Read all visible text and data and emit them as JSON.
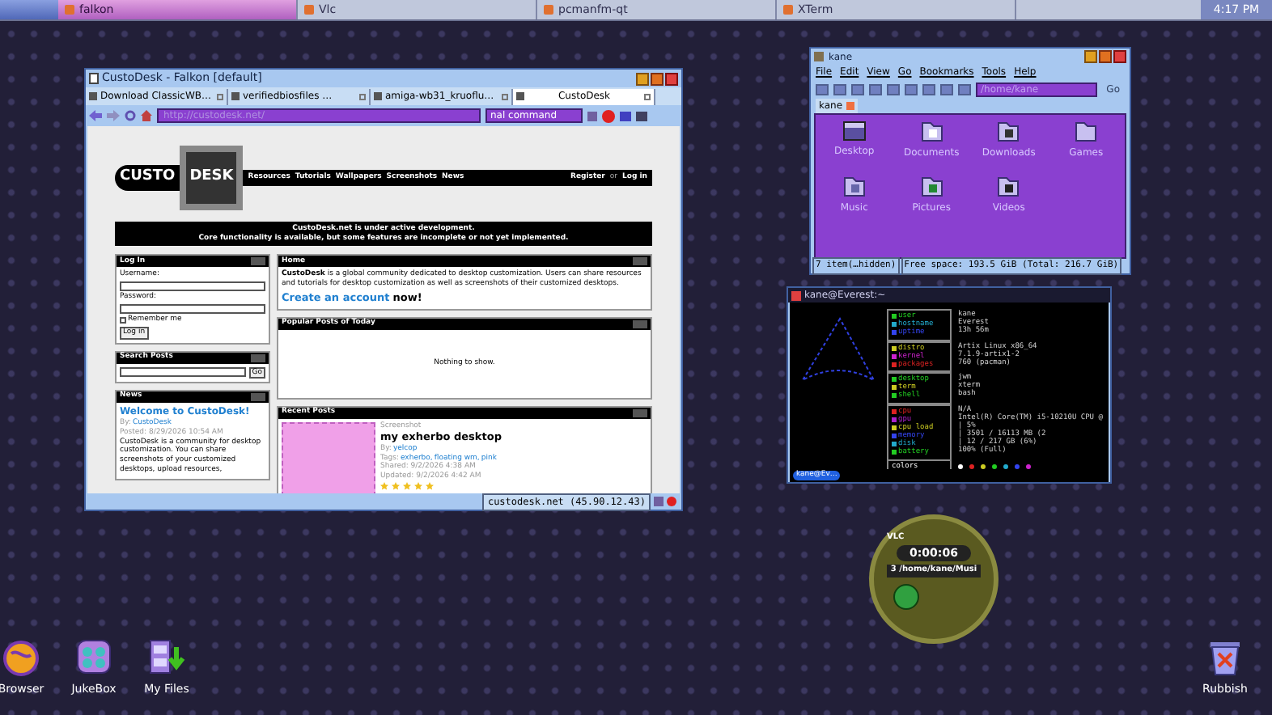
{
  "taskbar": {
    "tasks": [
      {
        "label": "falkon",
        "selected": true
      },
      {
        "label": "Vlc",
        "selected": false
      },
      {
        "label": "pcmanfm-qt",
        "selected": false
      },
      {
        "label": "XTerm",
        "selected": false
      }
    ],
    "clock": "4:17 PM"
  },
  "browser": {
    "title": "CustoDesk - Falkon [default]",
    "tabs": [
      {
        "label": "Download ClassicWB…",
        "selected": false
      },
      {
        "label": "verifiedbiosfiles …",
        "selected": false
      },
      {
        "label": "amiga-wb31_kruoflu…",
        "selected": false
      },
      {
        "label": "CustoDesk",
        "selected": true
      }
    ],
    "url": "http://custodesk.net/",
    "search": "nal command",
    "page": {
      "logo": [
        "CUSTO",
        "DESK"
      ],
      "nav": [
        "Resources",
        "Tutorials",
        "Wallpapers",
        "Screenshots",
        "News"
      ],
      "register": "Register",
      "or": "or",
      "login_link": "Log in",
      "notice": [
        "CustoDesk.net is under active development.",
        "Core functionality is available, but some features are incomplete or not yet implemented."
      ],
      "login": {
        "title": "Log In",
        "username": "Username:",
        "password": "Password:",
        "remember": {
          "label": "Remember me",
          "checked": false
        },
        "button": "Log in"
      },
      "search_posts": {
        "title": "Search Posts",
        "button": "Go"
      },
      "news": {
        "title": "News",
        "headline": "Welcome to CustoDesk!",
        "by": "By:",
        "author": "CustoDesk",
        "posted": "Posted: 8/29/2026 10:54 AM",
        "body": "CustoDesk is a community for desktop customization. You can share screenshots of your customized desktops, upload resources,"
      },
      "home": {
        "title": "Home",
        "body": "**CustoDesk** is a global community dedicated to desktop customization. Users can share resources and tutorials for desktop customization as well as screenshots of their customized desktops.",
        "cta_link": "Create an account",
        "cta_rest": "now!"
      },
      "popular": {
        "title": "Popular Posts of Today",
        "empty": "Nothing to show."
      },
      "recent": {
        "title": "Recent Posts",
        "category": "Screenshot",
        "post_title": "my exherbo desktop",
        "by": "By:",
        "author": "yelcop",
        "tags_label": "Tags:",
        "tags": [
          "exherbo,",
          "floating wm,",
          "pink"
        ],
        "shared": "Shared: 9/2/2026 4:38 AM",
        "updated": "Updated: 9/2/2026 4:42 AM",
        "stars": 5
      }
    },
    "status": "custodesk.net (45.90.12.43)"
  },
  "file_manager": {
    "title": "kane",
    "menu": [
      "File",
      "Edit",
      "View",
      "Go",
      "Bookmarks",
      "Tools",
      "Help"
    ],
    "path": "/home/kane",
    "go": "Go",
    "tab": "kane",
    "items": [
      {
        "label": "Desktop",
        "kind": "desktop"
      },
      {
        "label": "Documents",
        "kind": "documents"
      },
      {
        "label": "Downloads",
        "kind": "downloads"
      },
      {
        "label": "Games",
        "kind": "folder"
      },
      {
        "label": "Music",
        "kind": "music"
      },
      {
        "label": "Pictures",
        "kind": "pictures"
      },
      {
        "label": "Videos",
        "kind": "videos"
      }
    ],
    "status_items": "7 item(…hidden)",
    "status_space": "Free space: 193.5 GiB (Total: 216.7 GiB)"
  },
  "terminal": {
    "title": "kane@Everest:~",
    "groups": [
      [
        {
          "label": "user",
          "value": "kane",
          "color": "#22cc22"
        },
        {
          "label": "hostname",
          "value": "Everest",
          "color": "#22aacc"
        },
        {
          "label": "uptime",
          "value": "13h 56m",
          "color": "#3344ee"
        }
      ],
      [
        {
          "label": "distro",
          "value": "Artix Linux x86_64",
          "color": "#cccc22"
        },
        {
          "label": "kernel",
          "value": "7.1.9-artix1-2",
          "color": "#cc22cc"
        },
        {
          "label": "packages",
          "value": "760 (pacman)",
          "color": "#dd2222"
        }
      ],
      [
        {
          "label": "desktop",
          "value": "jwm",
          "color": "#22cc22"
        },
        {
          "label": "term",
          "value": "xterm",
          "color": "#cccc22"
        },
        {
          "label": "shell",
          "value": "bash",
          "color": "#22cc22"
        }
      ],
      [
        {
          "label": "cpu",
          "value": "N/A",
          "color": "#dd2222"
        },
        {
          "label": "gpu",
          "value": "Intel(R) Core(TM) i5-10210U CPU @",
          "color": "#aa22cc"
        },
        {
          "label": "cpu load",
          "value": "| 5%",
          "color": "#cccc22"
        },
        {
          "label": "memory",
          "value": "| 3501 / 16113 MB (2",
          "color": "#3344ee"
        },
        {
          "label": "disk",
          "value": "| 12 / 217 GB (6%)",
          "color": "#22aacc"
        },
        {
          "label": "battery",
          "value": "100% (Full)",
          "color": "#22cc22"
        }
      ]
    ],
    "colors_label": "colors",
    "palette": [
      {
        "color": "#ffffff"
      },
      {
        "color": "#dd2222"
      },
      {
        "color": "#cccc22"
      },
      {
        "color": "#22cc22"
      },
      {
        "color": "#22aacc"
      },
      {
        "color": "#3344ee"
      },
      {
        "color": "#cc22cc"
      }
    ],
    "tab": "kane@Ev…"
  },
  "vlc": {
    "logo": "VLC",
    "time": "0:00:06",
    "track": "3  /home/kane/Musi"
  },
  "desktop_icons": [
    {
      "label": "Browser",
      "kind": "browser"
    },
    {
      "label": "JukeBox",
      "kind": "jukebox"
    },
    {
      "label": "My Files",
      "kind": "files"
    },
    {
      "label": "Rubbish",
      "kind": "trash"
    }
  ]
}
